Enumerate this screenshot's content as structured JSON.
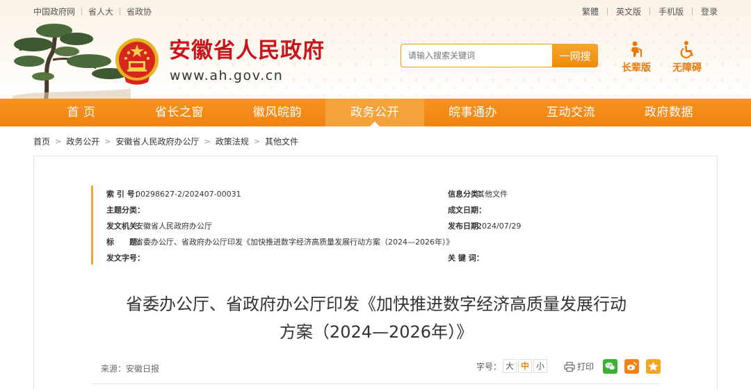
{
  "topbar": {
    "left_links": [
      "中国政府网",
      "省人大",
      "省政协"
    ],
    "right_links": [
      "繁體",
      "英文版",
      "手机版",
      "登录"
    ]
  },
  "brand": {
    "site_name": "安徽省人民政府",
    "site_url": "www.ah.gov.cn",
    "accent_color": "#c6161b",
    "orange": "#f08312"
  },
  "search": {
    "placeholder": "请输入搜索关键词",
    "button_label": "一网搜"
  },
  "tools": [
    {
      "label": "长辈版",
      "icon": "elder-icon"
    },
    {
      "label": "无障碍",
      "icon": "wheelchair-icon"
    }
  ],
  "nav": {
    "items": [
      "首 页",
      "省长之窗",
      "徽风皖韵",
      "政务公开",
      "皖事通办",
      "互动交流",
      "政府数据"
    ],
    "active": "政务公开"
  },
  "breadcrumb": [
    "首页",
    "政务公开",
    "安徽省人民政府办公厅",
    "政策法规",
    "其他文件"
  ],
  "meta": {
    "index_label": "索 引 号：",
    "index_value": "00298627-2/202407-00031",
    "topic_label": "主题分类：",
    "topic_value": "",
    "issuer_label": "发文机关：",
    "issuer_value": "安徽省人民政府办公厅",
    "heading_label": "标　　题：",
    "heading_value": "省委办公厅、省政府办公厅印发《加快推进数字经济高质量发展行动方案（2024—2026年）》",
    "docno_label": "发文字号：",
    "docno_value": "",
    "category_label": "信息分类：",
    "category_value": "其他文件",
    "date_label": "成文日期：",
    "date_value": "",
    "pubdate_label": "发布日期：",
    "pubdate_value": "2024/07/29",
    "keyword_label": "关 键 词：",
    "keyword_value": ""
  },
  "article": {
    "title_line1": "省委办公厅、省政府办公厅印发《加快推进数字经济高质量发展行动",
    "title_line2": "方案（2024—2026年）》",
    "source": "来源：安徽日报",
    "fontsize_label": "字号：",
    "fontsize_options": [
      "大",
      "中",
      "小"
    ],
    "fontsize_selected": "中",
    "print_label": "打印"
  },
  "share": [
    {
      "icon": "wechat-icon",
      "color": "#3cb034"
    },
    {
      "icon": "weibo-icon",
      "color": "#f08312"
    },
    {
      "icon": "favorite-icon",
      "color": "#f5a623"
    }
  ]
}
